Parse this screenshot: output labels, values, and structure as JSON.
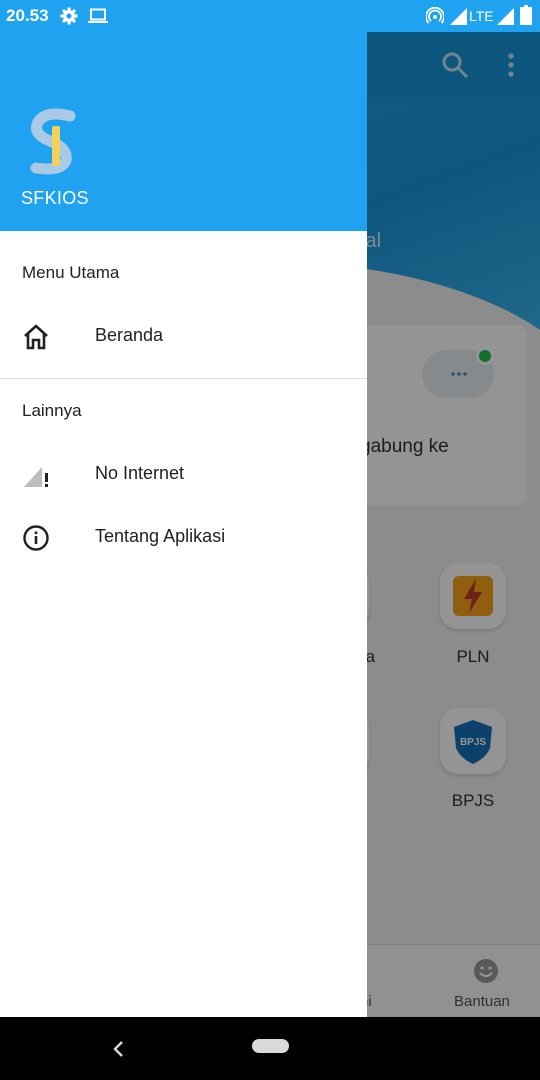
{
  "status_bar": {
    "time": "20.53",
    "network": "LTE",
    "icons": [
      "settings-icon",
      "laptop-icon",
      "hotspot-icon",
      "signal-icon",
      "battery-icon"
    ]
  },
  "drawer": {
    "app_name": "SFKIOS",
    "sections": [
      {
        "title": "Menu Utama",
        "items": [
          {
            "label": "Beranda",
            "icon": "home-icon"
          }
        ]
      },
      {
        "title": "Lainnya",
        "items": [
          {
            "label": "No Internet",
            "icon": "no-signal-icon"
          },
          {
            "label": "Tentang Aplikasi",
            "icon": "info-icon"
          }
        ]
      }
    ]
  },
  "background_app": {
    "hero_text": "tal",
    "card_text": "gabung ke",
    "tiles": [
      {
        "label": "ta"
      },
      {
        "label": "PLN"
      },
      {
        "label": "BPJS"
      }
    ],
    "bpjs_badge": "BPJS",
    "bottom_nav": [
      {
        "label": "ni"
      },
      {
        "label": "Bantuan"
      }
    ]
  },
  "colors": {
    "primary": "#1fa3f0",
    "drawer_bg": "#ffffff",
    "text": "#212121",
    "pln_orange": "#f7a21b",
    "bpjs_blue": "#1570b8",
    "online_dot": "#1fbf52"
  }
}
